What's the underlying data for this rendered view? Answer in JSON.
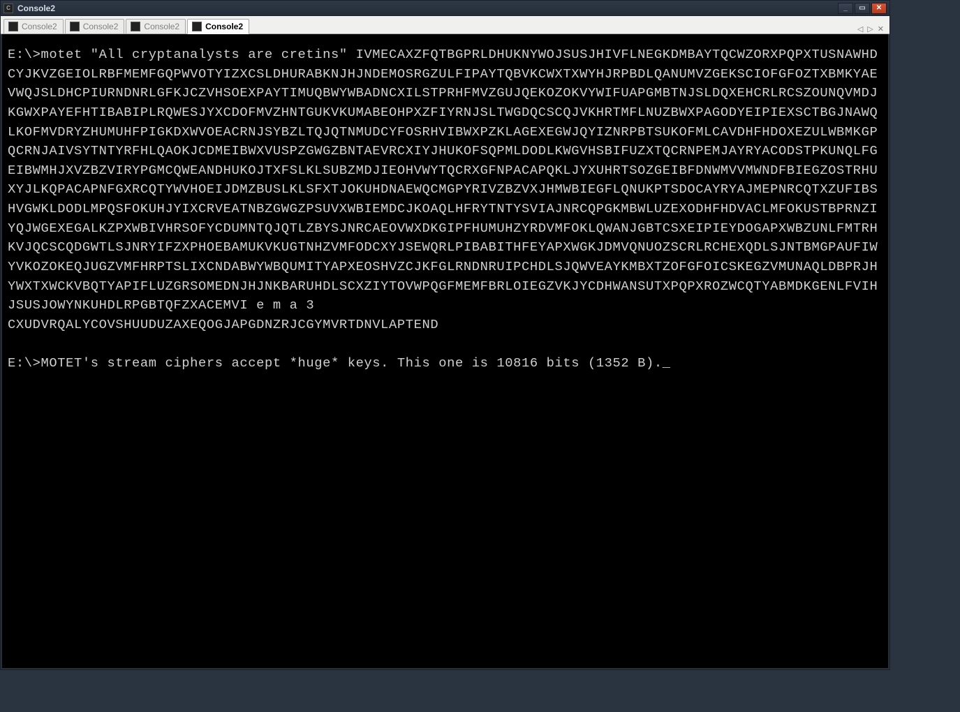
{
  "window": {
    "title": "Console2"
  },
  "tabs": [
    {
      "label": "Console2",
      "active": false
    },
    {
      "label": "Console2",
      "active": false
    },
    {
      "label": "Console2",
      "active": false
    },
    {
      "label": "Console2",
      "active": true
    }
  ],
  "tab_nav": {
    "prev": "◁",
    "next": "▷",
    "close": "✕"
  },
  "win_buttons": {
    "min": "_",
    "max": "▭",
    "close": "✕"
  },
  "terminal": {
    "line1": "E:\\>motet \"All cryptanalysts are cretins\" IVMECAXZFQTBGPRLDHUKNYWOJSUSJHIVFLNEGKDMBAYTQCWZORXPQPXTUSNAWHDCYJKVZGEIOLRBFMEMFGQPWVOTYIZXCSLDHURABKNJHJNDEMOSRGZULFIPAYTQBVKCWXTXWYHJRPBDLQANUMVZGEKSCIOFGFOZTXBMKYAEVWQJSLDHCPIURNDNRLGFKJCZVHSOEXPAYTIMUQBWYWBADNCXILSTPRHFMVZGUJQEKOZOKVYWIFUAPGMBTNJSLDQXEHCRLRCSZOUNQVMDJKGWXPAYEFHTIBABIPLRQWESJYXCDOFMVZHNTGUKVKUMABEOHPXZFIYRNJSLTWGDQCSCQJVKHRTMFLNUZBWXPAGODYEIPIEXSCTBGJNAWQLKOFMVDRYZHUMUHFPIGKDXWVOEACRNJSYBZLTQJQTNMUDCYFOSRHVIBWXPZKLAGEXEGWJQYIZNRPBTSUKOFMLCAVDHFHDOXEZULWBMKGPQCRNJAIVSYTNTYRFHLQAOKJCDMEIBWXVUSPZGWGZBNTAEVRCXIYJHUKOFSQPMLDODLKWGVHSBIFUZXTQCRNPEMJAYRYACODSTPKUNQLFGEIBWMHJXVZBZVIRYPGMCQWEANDHUKOJTXFSLKLSUBZMDJIEOHVWYTQCRXGFNPACAPQKLJYXUHRTSOZGEIBFDNWMVVMWNDFBIEGZOSTRHUXYJLKQPACAPNFGXRCQTYWVHOEIJDMZBUSLKLSFXTJOKUHDNAEWQCMGPYRIVZBZVXJHMWBIEGFLQNUKPTSDOCAYRYAJMEPNRCQTXZUFIBSHVGWKLDODLMPQSFOKUHJYIXCRVEATNBZGWGZPSUVXWBIEMDCJKOAQLHFRYTNTYSVIAJNRCQPGKMBWLUZEXODHFHDVACLMFOKUSTBPRNZIYQJWGEXEGALKZPXWBIVHRSOFYCDUMNTQJQTLZBYSJNRCAEOVWXDKGIPFHUMUHZYRDVMFOKLQWANJGBTCSXEIPIEYDOGAPXWBZUNLFMTRHKVJQCSCQDGWTLSJNRYIFZXPHOEBAMUKVKUGTNHZVMFODCXYJSEWQRLPIBABITHFEYAPXWGKJDMVQNUOZSCRLRCHEXQDLSJNTBMGPAUFIWYVKOZOKEQJUGZVMFHRPTSLIXCNDABWYWBQUMITYAPXEOSHVZCJKFGLRNDNRUIPCHDLSJQWVEAYKMBXTZOFGFOICSKEGZVMUNAQLDBPRJHYWXTXWCKVBQTYAPIFLUZGRSOMEDNJHJNKBARUHDLSCXZIYTOVWPQGFMEMFBRLOIEGZVKJYCDHWANSUTXPQPXROZWCQTYABMDKGENLFVIHJSUSJOWYNKUHDLRPGBTQFZXACEMVI e m a 3",
    "line2": "CXUDVRQALYCOVSHUUDUZAXEQOGJAPGDNZRJCGYMVRTDNVLAPTEND",
    "line3": "E:\\>MOTET's stream ciphers accept *huge* keys. This one is 10816 bits (1352 B).",
    "cursor": "_"
  }
}
